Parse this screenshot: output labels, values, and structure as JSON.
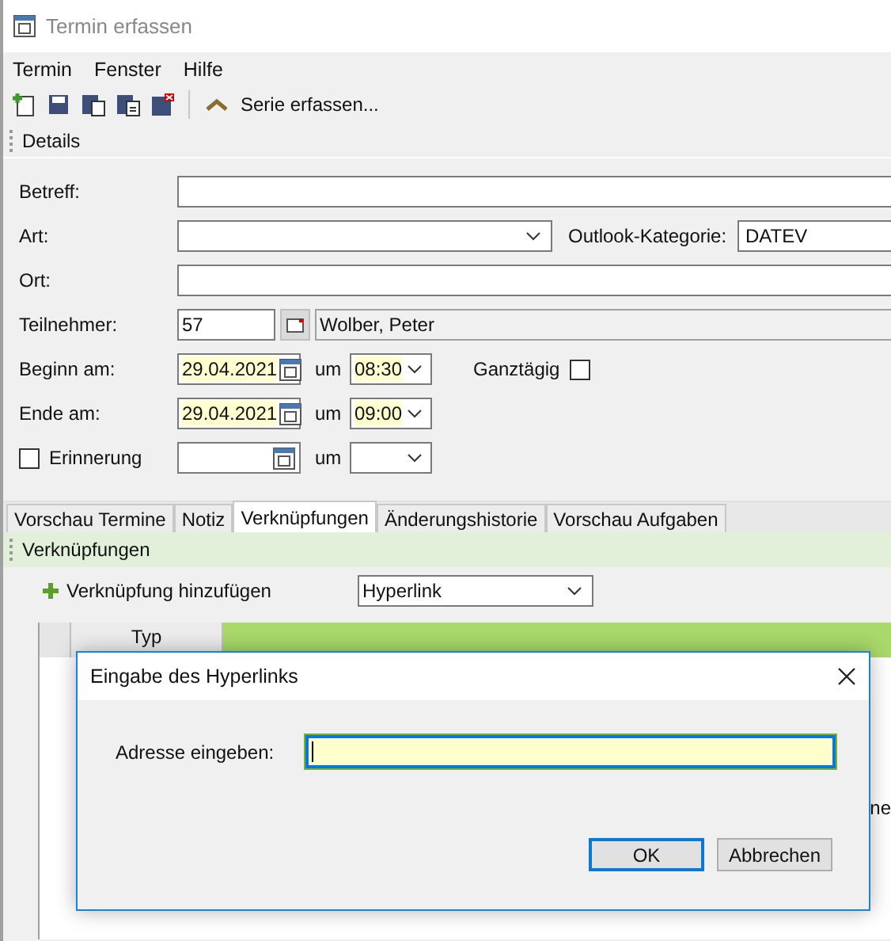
{
  "window": {
    "title": "Termin erfassen"
  },
  "menu": [
    "Termin",
    "Fenster",
    "Hilfe"
  ],
  "toolbar": {
    "action": "Serie erfassen..."
  },
  "details_header": "Details",
  "form": {
    "betreff": {
      "label": "Betreff:"
    },
    "art": {
      "label": "Art:"
    },
    "outlook_kategorie": {
      "label": "Outlook-Kategorie:",
      "value": "DATEV"
    },
    "ort": {
      "label": "Ort:"
    },
    "teilnehmer": {
      "label": "Teilnehmer:",
      "value": "57",
      "name": "Wolber, Peter"
    },
    "beginn": {
      "label": "Beginn am:",
      "date": "29.04.2021",
      "time_label": "um",
      "time": "08:30"
    },
    "ganztaegig": {
      "label": "Ganztägig",
      "checked": false
    },
    "ende": {
      "label": "Ende am:",
      "date": "29.04.2021",
      "time_label": "um",
      "time": "09:00"
    },
    "erinnerung": {
      "label": "Erinnerung",
      "checked": false,
      "time_label": "um"
    }
  },
  "tabs": [
    {
      "label": "Vorschau Termine",
      "selected": false
    },
    {
      "label": "Notiz",
      "selected": false
    },
    {
      "label": "Verknüpfungen",
      "selected": true
    },
    {
      "label": "Änderungshistorie",
      "selected": false
    },
    {
      "label": "Vorschau Aufgaben",
      "selected": false
    }
  ],
  "section": {
    "title": "Verknüpfungen",
    "add_label": "Verknüpfung hinzufügen",
    "type": "Hyperlink"
  },
  "grid": {
    "columns": [
      "Typ"
    ],
    "fragment": "ne"
  },
  "dialog": {
    "title": "Eingabe des Hyperlinks",
    "label": "Adresse eingeben:",
    "buttons": [
      {
        "label": "OK",
        "default": true
      },
      {
        "label": "Abbrechen",
        "default": false
      }
    ]
  }
}
